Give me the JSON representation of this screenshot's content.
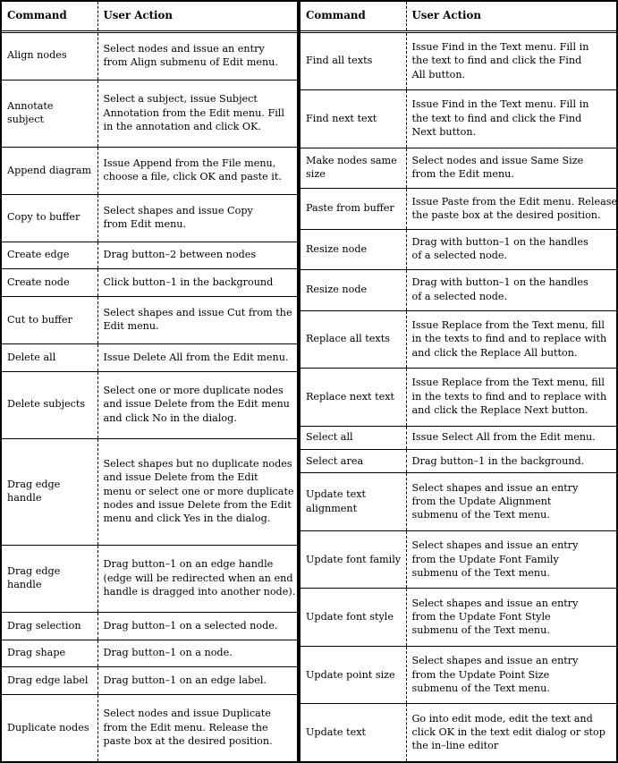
{
  "document": {
    "kind": "reference-table",
    "title": "Command / User Action reference table",
    "columns_per_half": [
      "Command",
      "User Action"
    ]
  },
  "left_table": {
    "headers": {
      "command": "Command",
      "action": "User Action"
    },
    "rows": [
      {
        "command": "Align nodes",
        "action": [
          "Select nodes and issue an entry",
          "from Align submenu of Edit menu."
        ]
      },
      {
        "command": "Annotate subject",
        "action": [
          "Select a subject, issue Subject",
          "Annotation from the Edit menu. Fill",
          "in the annotation and click OK."
        ]
      },
      {
        "command": "Append diagram",
        "action": [
          "Issue Append from the File menu,",
          "choose a file, click OK and paste it."
        ]
      },
      {
        "command": "Copy to buffer",
        "action": [
          "Select shapes and issue Copy",
          "from Edit menu."
        ]
      },
      {
        "command": "Create edge",
        "action": [
          "Drag button–2 between nodes"
        ]
      },
      {
        "command": "Create node",
        "action": [
          "Click button–1 in the background"
        ]
      },
      {
        "command": "Cut to buffer",
        "action": [
          "Select shapes and issue Cut from the",
          "Edit menu."
        ]
      },
      {
        "command": "Delete all",
        "action": [
          "Issue Delete All from the Edit menu."
        ]
      },
      {
        "command": "Delete subjects",
        "action": [
          "Select one or more duplicate nodes",
          "and issue Delete from the Edit menu",
          "and click No in the dialog."
        ]
      },
      {
        "command": "Drag edge handle",
        "action": [
          "Select shapes but  no duplicate nodes",
          "and issue Delete from the Edit",
          "menu or select one or more duplicate",
          "nodes and issue Delete from the Edit",
          "menu and click Yes in the dialog."
        ]
      },
      {
        "command": "Drag edge handle",
        "action": [
          "Drag button–1 on an edge handle",
          "(edge will be redirected when an end",
          "handle is dragged into another node)."
        ]
      },
      {
        "command": "Drag selection",
        "action": [
          "Drag button–1 on a selected node."
        ]
      },
      {
        "command": "Drag shape",
        "action": [
          "Drag button–1 on a node."
        ]
      },
      {
        "command": "Drag edge label",
        "action": [
          "Drag button–1 on an edge label."
        ]
      },
      {
        "command": "Duplicate nodes",
        "action": [
          "Select nodes and issue Duplicate",
          "from the Edit menu. Release the",
          "paste box at the desired position."
        ]
      }
    ]
  },
  "right_table": {
    "headers": {
      "command": "Command",
      "action": "User Action"
    },
    "rows": [
      {
        "command": "Find all texts",
        "action": [
          "Issue Find in the Text menu. Fill in",
          "the text to find and click the Find",
          "All button."
        ]
      },
      {
        "command": "Find next text",
        "action": [
          "Issue Find in the Text menu. Fill in",
          "the text to find and click the Find",
          "Next button."
        ]
      },
      {
        "command": "Make nodes same size",
        "action": [
          "Select nodes and issue Same Size",
          "from the Edit menu."
        ]
      },
      {
        "command": "Paste from buffer",
        "action": [
          "Issue Paste from the Edit menu. Release",
          "the paste box at the desired position."
        ]
      },
      {
        "command": "Resize node",
        "action": [
          "Drag with button–1 on the handles",
          "of a selected node."
        ]
      },
      {
        "command": "Resize node",
        "action": [
          "Drag with button–1 on the handles",
          "of a selected node."
        ]
      },
      {
        "command": "Replace all texts",
        "action": [
          "Issue Replace from the Text menu, fill",
          "in the texts to find and to replace with",
          "and click the Replace All button."
        ]
      },
      {
        "command": "Replace next text",
        "action": [
          "Issue Replace from the Text menu, fill",
          "in the texts to find and to replace with",
          "and click the Replace Next button."
        ]
      },
      {
        "command": "Select all",
        "action": [
          "Issue Select All from the Edit menu."
        ]
      },
      {
        "command": "Select area",
        "action": [
          "Drag button–1 in the background."
        ]
      },
      {
        "command": "Update text alignment",
        "action": [
          "Select shapes and issue an entry",
          "from the Update Alignment",
          "submenu of the Text menu."
        ]
      },
      {
        "command": "Update font family",
        "action": [
          "Select shapes and issue an entry",
          "from the Update Font Family",
          "submenu of the Text menu."
        ]
      },
      {
        "command": "Update font style",
        "action": [
          "Select shapes and issue an entry",
          "from the Update Font Style",
          "submenu of the Text menu."
        ]
      },
      {
        "command": "Update point size",
        "action": [
          "Select shapes and issue an entry",
          "from the Update Point Size",
          "submenu of the Text menu."
        ]
      },
      {
        "command": "Update text",
        "action": [
          "Go into edit mode, edit the text and",
          "click OK in the text edit dialog or stop",
          "the in–line editor"
        ]
      }
    ]
  },
  "style": {
    "border_color": "#000000",
    "background": "#ffffff",
    "text_color": "#000000"
  }
}
